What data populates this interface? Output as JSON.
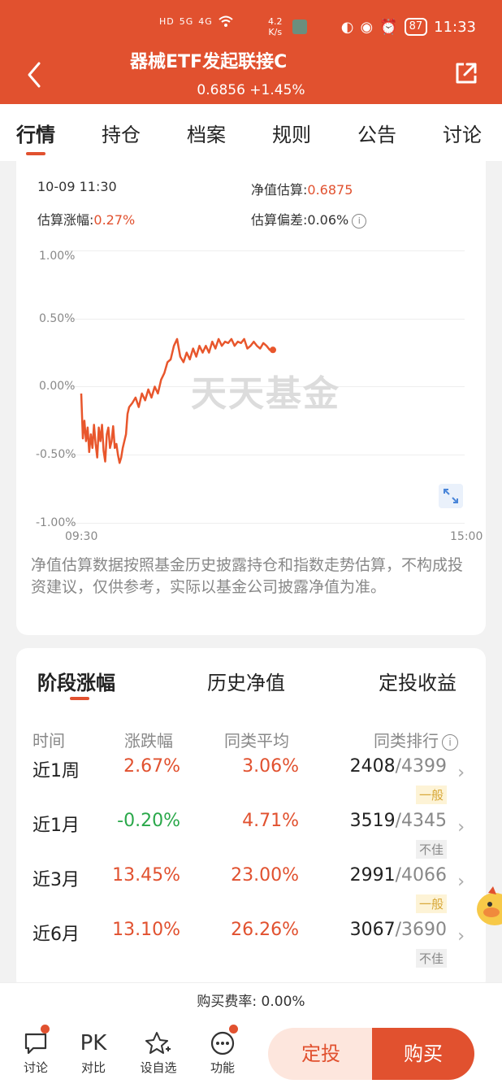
{
  "status_bar": {
    "left_icons": [
      "HD",
      "5G",
      "4G",
      "wifi"
    ],
    "network_speed": "4.2",
    "network_unit": "K/s",
    "battery": "87",
    "time": "11:33"
  },
  "header": {
    "title": "器械ETF发起联接C",
    "subtitle": "0.6856 +1.45%"
  },
  "tabs": [
    "行情",
    "持仓",
    "档案",
    "规则",
    "公告",
    "讨论"
  ],
  "estimate": {
    "datetime": "10-09 11:30",
    "nav_est_label": "净值估算:",
    "nav_est_value": "0.6875",
    "change_label": "估算涨幅:",
    "change_value": "0.27%",
    "deviation_label": "估算偏差:",
    "deviation_value": "0.06%"
  },
  "chart_data": {
    "type": "line",
    "title": "",
    "xlabel": "",
    "ylabel": "",
    "y_ticks": [
      "1.00%",
      "0.50%",
      "0.00%",
      "-0.50%",
      "-1.00%"
    ],
    "ylim": [
      -1.0,
      1.0
    ],
    "x_ticks": [
      "09:30",
      "15:00"
    ],
    "x_minutes_range": [
      0,
      240
    ],
    "watermark": "天天基金",
    "series": [
      {
        "color": "#e8562c",
        "x": [
          0,
          1,
          2,
          3,
          4,
          5,
          6,
          7,
          8,
          9,
          10,
          11,
          12,
          13,
          14,
          15,
          16,
          17,
          18,
          19,
          20,
          21,
          22,
          23,
          24,
          25,
          26,
          27,
          28,
          29,
          30,
          32,
          34,
          36,
          38,
          40,
          42,
          44,
          46,
          48,
          50,
          52,
          54,
          56,
          58,
          60,
          62,
          64,
          66,
          68,
          70,
          72,
          74,
          76,
          78,
          80,
          82,
          84,
          86,
          88,
          90,
          92,
          94,
          96,
          98,
          100,
          102,
          104,
          106,
          108,
          110,
          112,
          114,
          116,
          118,
          120
        ],
        "y": [
          -0.05,
          -0.38,
          -0.25,
          -0.4,
          -0.3,
          -0.48,
          -0.35,
          -0.45,
          -0.28,
          -0.42,
          -0.52,
          -0.3,
          -0.4,
          -0.28,
          -0.47,
          -0.55,
          -0.35,
          -0.3,
          -0.45,
          -0.4,
          -0.29,
          -0.45,
          -0.42,
          -0.5,
          -0.56,
          -0.52,
          -0.45,
          -0.4,
          -0.35,
          -0.2,
          -0.15,
          -0.12,
          -0.08,
          -0.15,
          -0.05,
          -0.1,
          -0.02,
          -0.08,
          0.0,
          -0.05,
          0.05,
          0.1,
          0.18,
          0.2,
          0.3,
          0.35,
          0.22,
          0.18,
          0.25,
          0.2,
          0.28,
          0.22,
          0.3,
          0.25,
          0.3,
          0.25,
          0.33,
          0.28,
          0.35,
          0.3,
          0.33,
          0.32,
          0.35,
          0.3,
          0.33,
          0.32,
          0.35,
          0.28,
          0.3,
          0.33,
          0.3,
          0.28,
          0.32,
          0.3,
          0.27,
          0.27
        ]
      }
    ]
  },
  "disclaimer": "净值估算数据按照基金历史披露持仓和指数走势估算，不构成投资建议，仅供参考，实际以基金公司披露净值为准。",
  "section_tabs": [
    "阶段涨幅",
    "历史净值",
    "定投收益"
  ],
  "perf_table": {
    "headers": [
      "时间",
      "涨跌幅",
      "同类平均",
      "同类排行"
    ],
    "rows": [
      {
        "period": "近1周",
        "change": "2.67%",
        "change_color": "red",
        "avg": "3.06%",
        "rank": "2408",
        "total": "/4399",
        "tag": "一般",
        "tag_type": "ok"
      },
      {
        "period": "近1月",
        "change": "-0.20%",
        "change_color": "green",
        "avg": "4.71%",
        "rank": "3519",
        "total": "/4345",
        "tag": "不佳",
        "tag_type": "bad"
      },
      {
        "period": "近3月",
        "change": "13.45%",
        "change_color": "red",
        "avg": "23.00%",
        "rank": "2991",
        "total": "/4066",
        "tag": "一般",
        "tag_type": "ok"
      },
      {
        "period": "近6月",
        "change": "13.10%",
        "change_color": "red",
        "avg": "26.26%",
        "rank": "3067",
        "total": "/3690",
        "tag": "不佳",
        "tag_type": "bad"
      }
    ]
  },
  "fee": "购买费率: 0.00%",
  "bottom_nav": [
    {
      "label": "讨论",
      "icon": "chat-icon",
      "dot": true
    },
    {
      "label": "对比",
      "icon": "pk-icon",
      "glyph": "PK",
      "dot": false
    },
    {
      "label": "设自选",
      "icon": "star-plus-icon",
      "dot": false
    },
    {
      "label": "功能",
      "icon": "more-icon",
      "dot": true
    }
  ],
  "buttons": {
    "auto_invest": "定投",
    "buy": "购买"
  },
  "colors": {
    "brand": "#e1512f",
    "up": "#e1512f",
    "down": "#2aa84a"
  }
}
